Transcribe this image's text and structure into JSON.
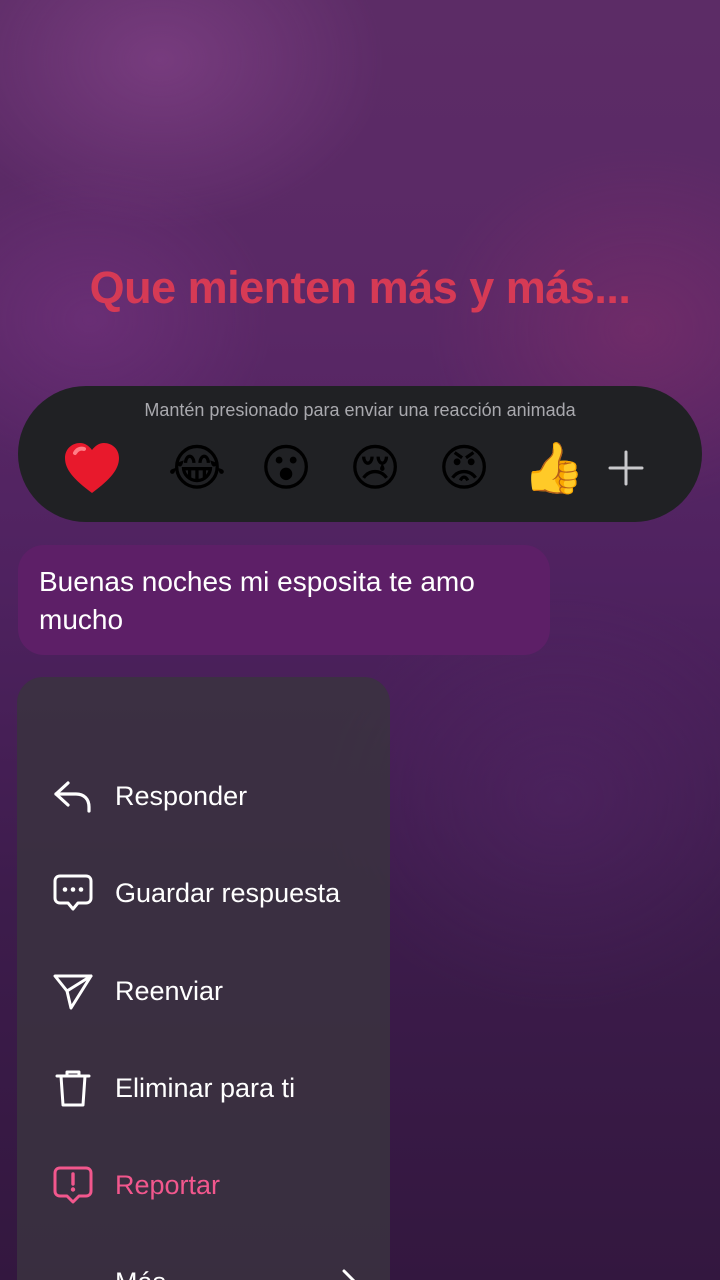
{
  "overlay": {
    "title": "Que mienten más y más..."
  },
  "reactions": {
    "hint": "Mantén presionado para enviar una reacción animada",
    "items": [
      {
        "name": "heart",
        "glyph": "❤️"
      },
      {
        "name": "joy",
        "glyph": "😂"
      },
      {
        "name": "surprised",
        "glyph": "😮"
      },
      {
        "name": "crying",
        "glyph": "😢"
      },
      {
        "name": "angry",
        "glyph": "😡"
      },
      {
        "name": "thumbs-up",
        "glyph": "👍"
      }
    ],
    "more_icon": "plus-icon"
  },
  "message": {
    "text": "Buenas noches mi esposita te amo mucho",
    "bubble_color": "#5d1f67"
  },
  "menu": {
    "items": [
      {
        "label": "Responder",
        "icon": "reply-icon"
      },
      {
        "label": "Guardar respuesta",
        "icon": "saved-reply-icon"
      },
      {
        "label": "Reenviar",
        "icon": "forward-icon"
      },
      {
        "label": "Eliminar para ti",
        "icon": "trash-icon"
      },
      {
        "label": "Reportar",
        "icon": "report-icon",
        "color": "#f2578d"
      },
      {
        "label": "Más",
        "icon": "chevron-right-icon"
      }
    ]
  },
  "colors": {
    "accent_danger": "#f2578d",
    "title_red": "#d63a55",
    "reaction_bar": "#202124"
  }
}
